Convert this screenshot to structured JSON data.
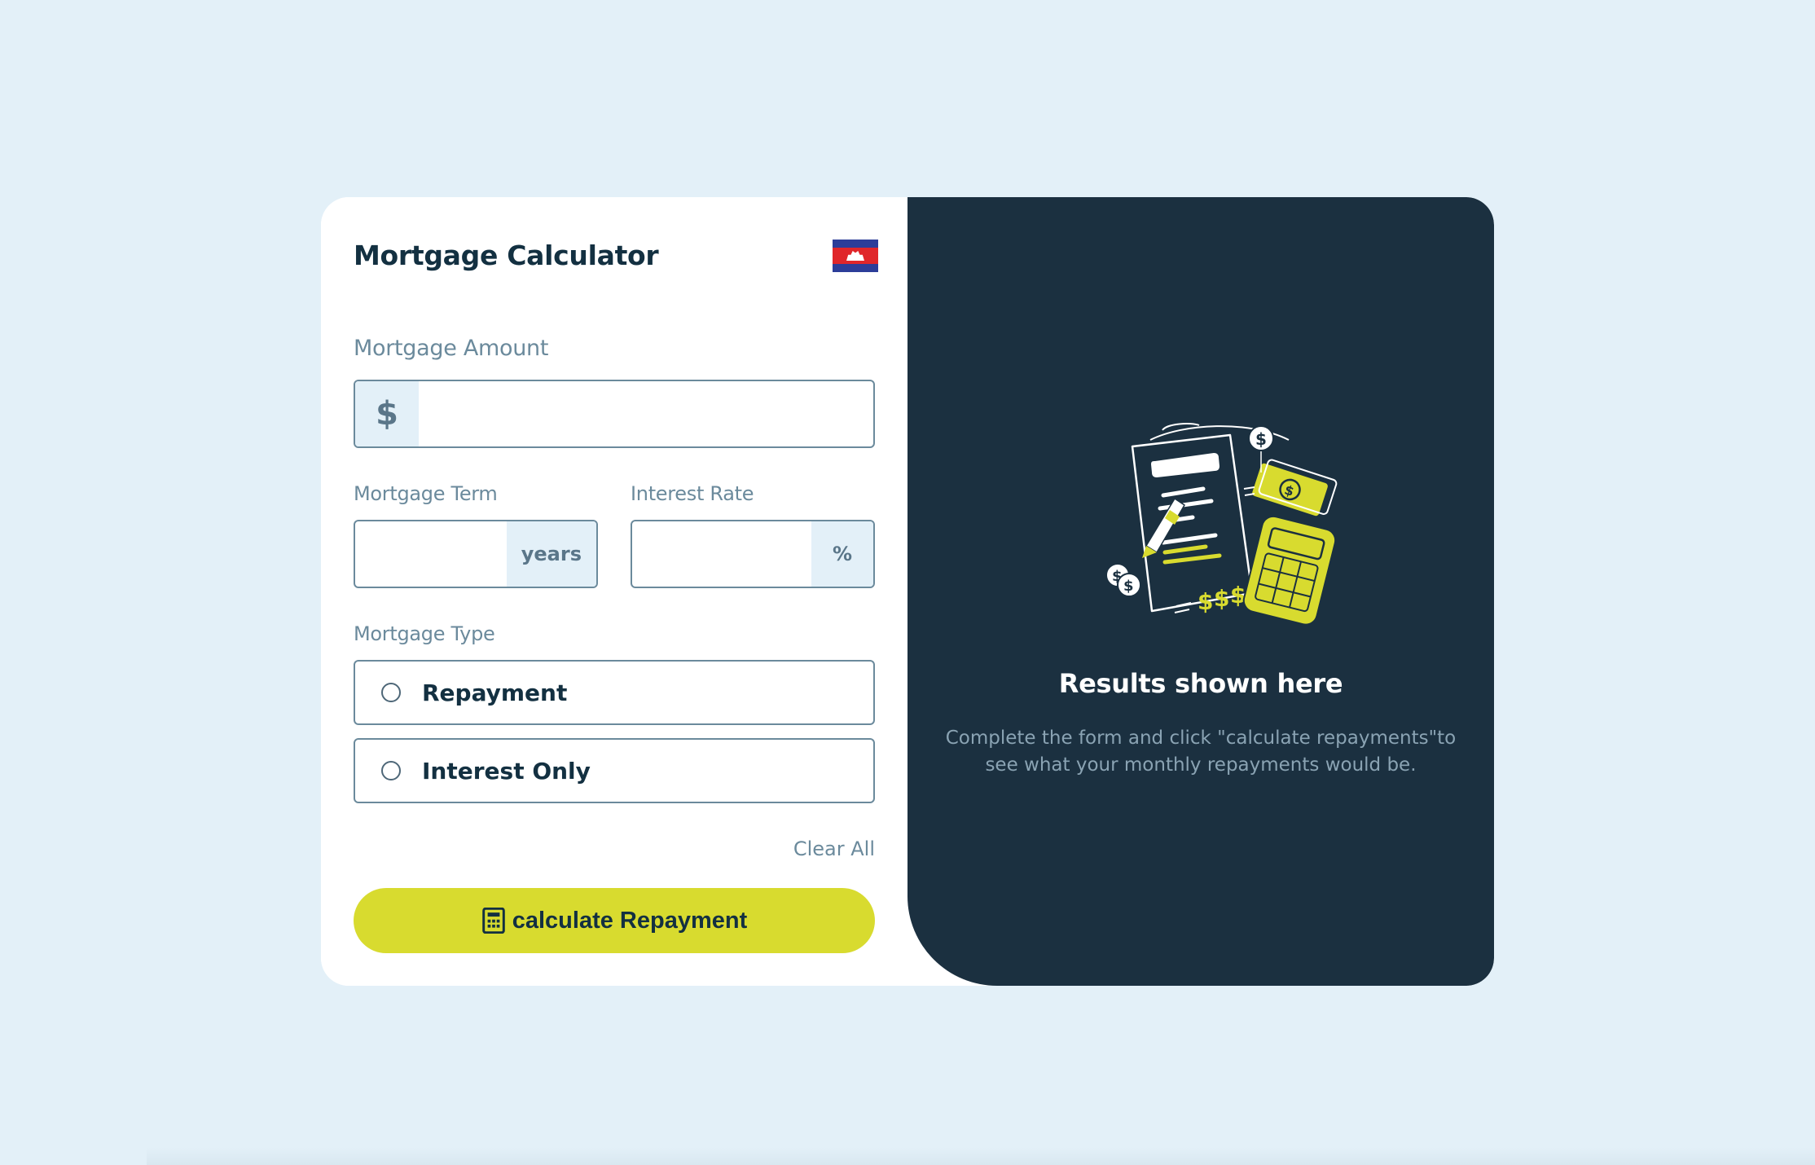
{
  "form": {
    "title": "Mortgage Calculator",
    "flag_icon": "cambodia-flag-icon",
    "amount": {
      "label": "Mortgage Amount",
      "prefix": "$",
      "value": ""
    },
    "term": {
      "label": "Mortgage Term",
      "suffix": "years",
      "value": ""
    },
    "rate": {
      "label": "Interest Rate",
      "suffix": "%",
      "value": ""
    },
    "type": {
      "label": "Mortgage Type",
      "options": [
        {
          "label": "Repayment",
          "selected": false
        },
        {
          "label": "Interest Only",
          "selected": false
        }
      ]
    },
    "clear_label": "Clear All",
    "submit_label": "calculate Repayment",
    "submit_icon": "calculator-icon"
  },
  "results": {
    "illustration": "empty-results-illustration",
    "title": "Results shown here",
    "description": "Complete the form and click \"calculate repayments\"to see what your monthly repayments would be."
  },
  "colors": {
    "background": "#e3f0f8",
    "panel_dark": "#1b3040",
    "accent_lime": "#d8db2f",
    "text_dark": "#133041",
    "text_muted": "#6b8a9c"
  }
}
